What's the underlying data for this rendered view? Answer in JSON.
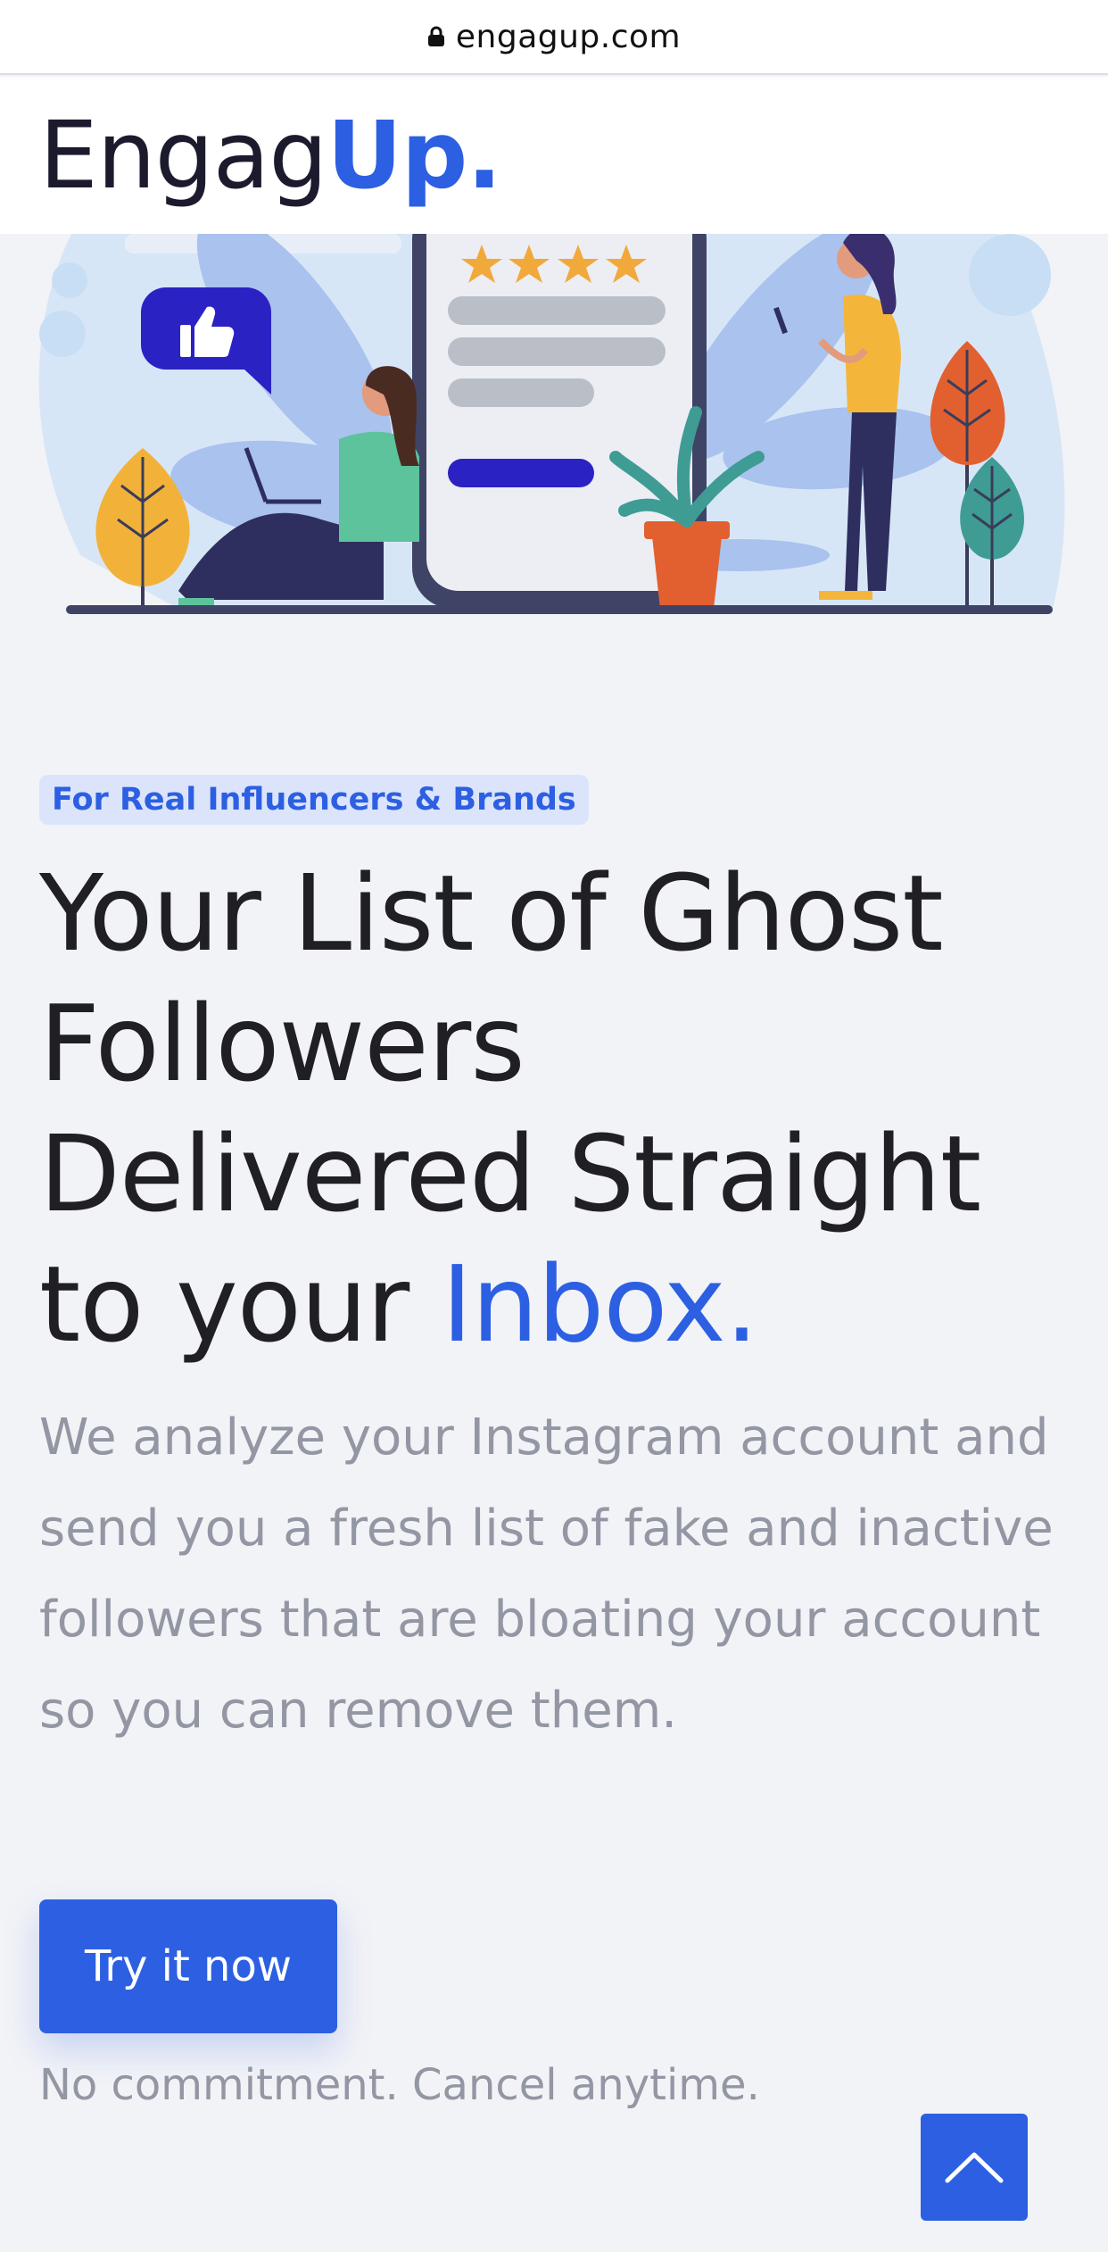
{
  "browser": {
    "url": "engagup.com"
  },
  "header": {
    "logo_part1": "Engag",
    "logo_part2": "Up."
  },
  "hero": {
    "badge": "For Real Influencers & Brands",
    "headline_line1": "Your List of Ghost",
    "headline_line2": "Followers",
    "headline_line3": "Delivered Straight",
    "headline_line4_prefix": "to your ",
    "headline_accent": "Inbox.",
    "description": "We analyze your Instagram account and send you a fresh list of fake and inactive followers that are bloating your account so you can remove them.",
    "cta_label": "Try it now",
    "note": "No commitment. Cancel anytime.",
    "rating_stars": 4
  },
  "icons": {
    "lock": "lock-icon",
    "thumbs_up": "thumbs-up-icon",
    "star": "star-icon",
    "back_to_top": "chevron-up-icon"
  },
  "colors": {
    "accent": "#2c5fe2",
    "text": "#1f1f24",
    "muted": "#9396a3",
    "badge_bg": "#dbe4fb",
    "background": "#f2f3f7"
  }
}
